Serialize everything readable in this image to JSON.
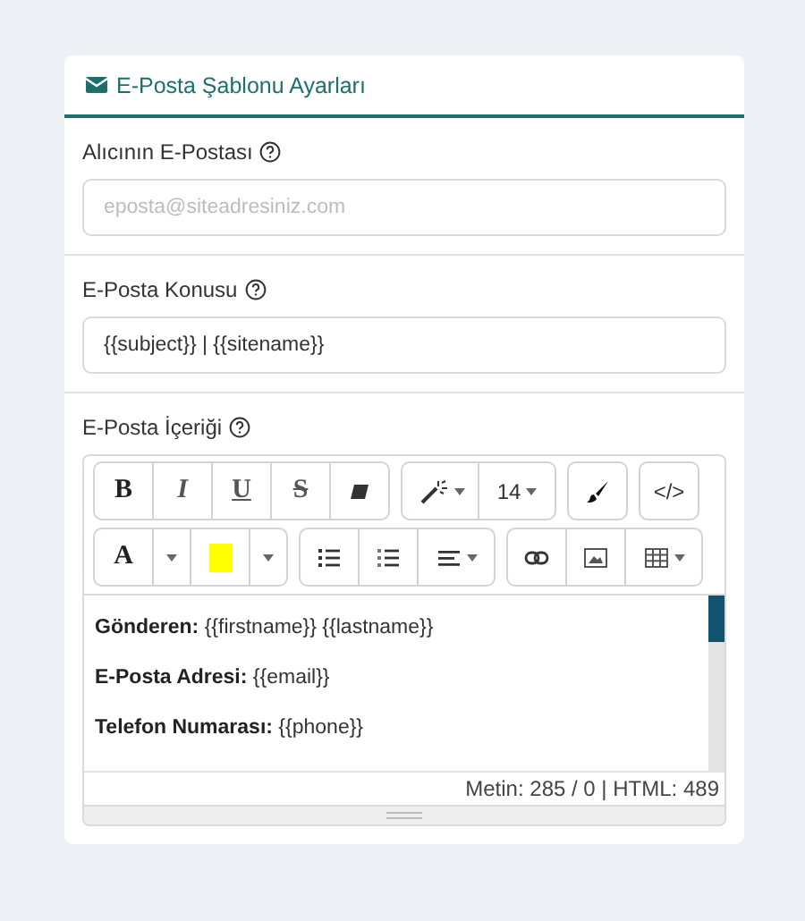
{
  "card": {
    "title": "E-Posta Şablonu Ayarları"
  },
  "fields": [
    {
      "label": "Alıcının E-Postası",
      "placeholder": "eposta@siteadresiniz.com"
    },
    {
      "label": "E-Posta Konusu",
      "value": "{{subject}} | {{sitename}}"
    }
  ],
  "editor": {
    "label": "E-Posta İçeriği",
    "toolbar": {
      "bold": "B",
      "italic": "I",
      "underline": "U",
      "strike": "S",
      "font_size": "14",
      "code_view": "</>",
      "font_color": "A"
    },
    "content": [
      "**Gönderen:** {{firstname}} {{lastname}}",
      "**E-Posta Adresi:** {{email}}",
      "**Telefon Numarası:** {{phone}}"
    ],
    "status": "Metin: 285 / 0 | HTML: 489"
  }
}
